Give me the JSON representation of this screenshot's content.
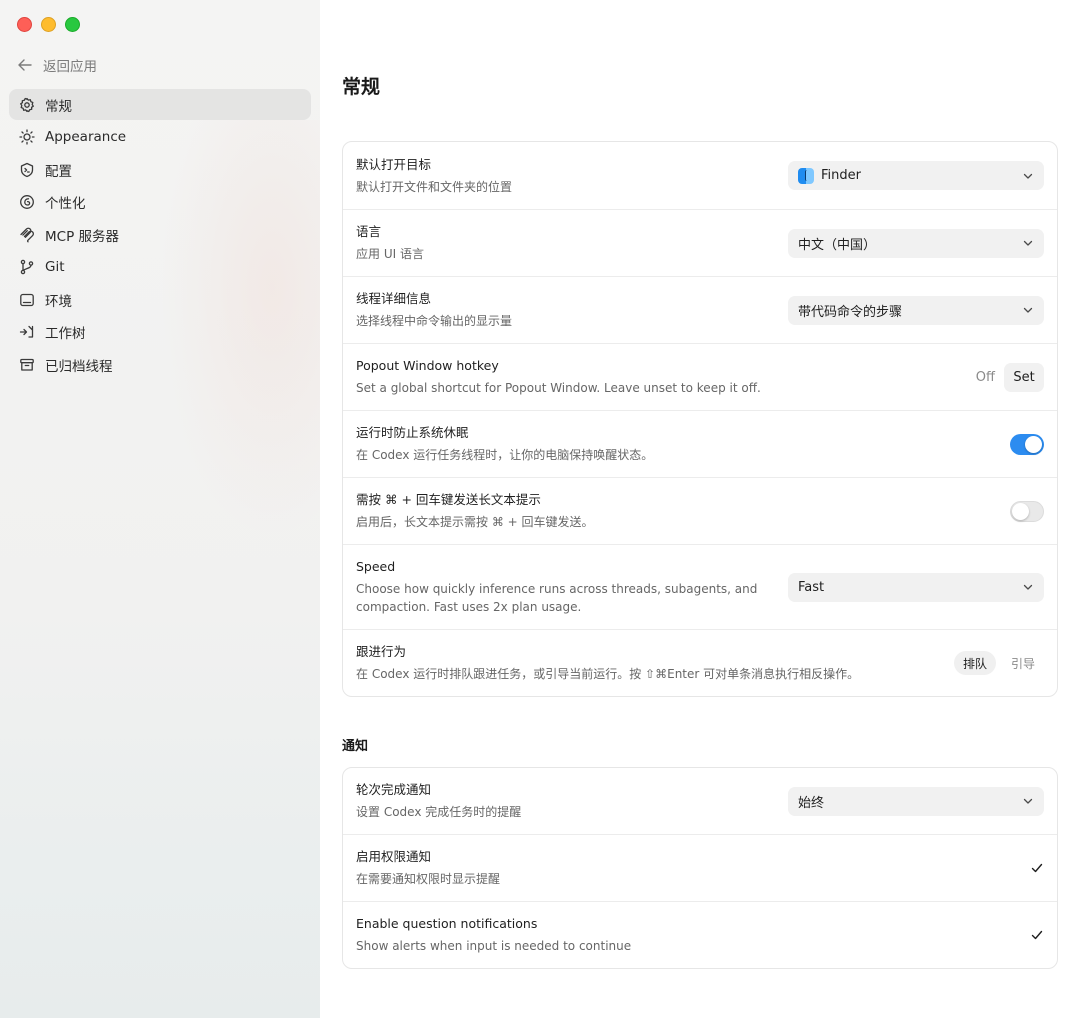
{
  "sidebar": {
    "back_label": "返回应用",
    "items": [
      {
        "label": "常规",
        "icon": "gear-icon",
        "active": true
      },
      {
        "label": "Appearance",
        "icon": "sun-icon",
        "active": false
      },
      {
        "label": "配置",
        "icon": "config-icon",
        "active": false
      },
      {
        "label": "个性化",
        "icon": "personalize-icon",
        "active": false
      },
      {
        "label": "MCP 服务器",
        "icon": "mcp-icon",
        "active": false
      },
      {
        "label": "Git",
        "icon": "git-branch-icon",
        "active": false
      },
      {
        "label": "环境",
        "icon": "environment-icon",
        "active": false
      },
      {
        "label": "工作树",
        "icon": "worktree-icon",
        "active": false
      },
      {
        "label": "已归档线程",
        "icon": "archive-icon",
        "active": false
      }
    ]
  },
  "main": {
    "title": "常规",
    "general": {
      "open_target": {
        "title": "默认打开目标",
        "desc": "默认打开文件和文件夹的位置",
        "value": "Finder"
      },
      "language": {
        "title": "语言",
        "desc": "应用 UI 语言",
        "value": "中文（中国）"
      },
      "thread_detail": {
        "title": "线程详细信息",
        "desc": "选择线程中命令输出的显示量",
        "value": "带代码命令的步骤"
      },
      "popout_hotkey": {
        "title": "Popout Window hotkey",
        "desc": "Set a global shortcut for Popout Window. Leave unset to keep it off.",
        "state_label": "Off",
        "set_label": "Set"
      },
      "prevent_sleep": {
        "title": "运行时防止系统休眠",
        "desc": "在 Codex 运行任务线程时，让你的电脑保持唤醒状态。",
        "enabled": true
      },
      "cmd_enter": {
        "title": "需按 ⌘ + 回车键发送长文本提示",
        "desc": "启用后，长文本提示需按 ⌘ + 回车键发送。",
        "enabled": false
      },
      "speed": {
        "title": "Speed",
        "desc_line1": "Choose how quickly inference runs across threads, subagents, and",
        "desc_line2": "compaction. Fast uses 2x plan usage.",
        "value": "Fast"
      },
      "follow_up": {
        "title": "跟进行为",
        "desc": "在 Codex 运行时排队跟进任务，或引导当前运行。按 ⇧⌘Enter 可对单条消息执行相反操作。",
        "option_queue": "排队",
        "option_steer": "引导",
        "selected": "排队"
      }
    },
    "notify_section_title": "通知",
    "notify": {
      "turn_complete": {
        "title": "轮次完成通知",
        "desc": "设置 Codex 完成任务时的提醒",
        "value": "始终"
      },
      "permission": {
        "title": "启用权限通知",
        "desc": "在需要通知权限时显示提醒",
        "checked": true
      },
      "question": {
        "title": "Enable question notifications",
        "desc": "Show alerts when input is needed to continue",
        "checked": true
      }
    }
  },
  "colors": {
    "accent": "#2c8cf0",
    "close": "#fe5f57",
    "minimize": "#febc2e",
    "maximize": "#28c840"
  }
}
